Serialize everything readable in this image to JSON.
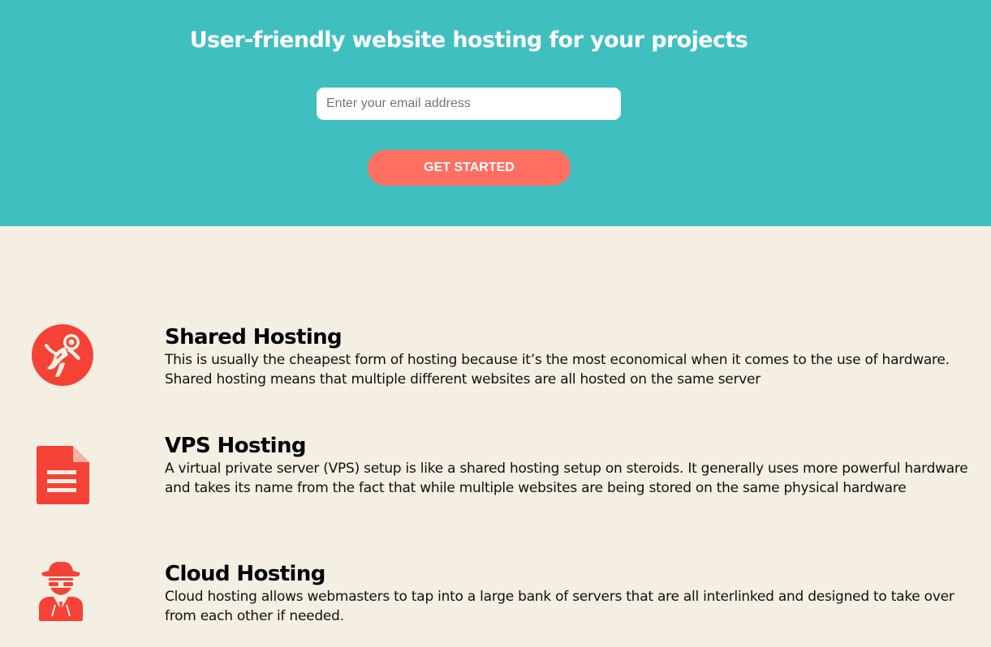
{
  "hero": {
    "title": "User-friendly website hosting for your projects",
    "email_placeholder": "Enter your email address",
    "cta_label": "GET STARTED",
    "background_color": "#40bfc1",
    "button_color": "#ff6f61"
  },
  "features": [
    {
      "icon": "astronaut-icon",
      "title": "Shared Hosting",
      "description": "This is usually the cheapest form of hosting because it’s the most economical when it comes to the use of hardware. Shared hosting means that multiple different websites are all hosted on the same server"
    },
    {
      "icon": "document-icon",
      "title": "VPS Hosting",
      "description": "A virtual private server (VPS) setup is like a shared hosting setup on steroids. It generally uses more powerful hardware and takes its name from the fact that while multiple websites are being stored on the same physical hardware"
    },
    {
      "icon": "spy-icon",
      "title": "Cloud Hosting",
      "description": "Cloud hosting allows webmasters to tap into a large bank of servers that are all interlinked and designed to take over from each other if needed."
    }
  ],
  "accent_color": "#f44336",
  "page_background": "#f5eee2"
}
